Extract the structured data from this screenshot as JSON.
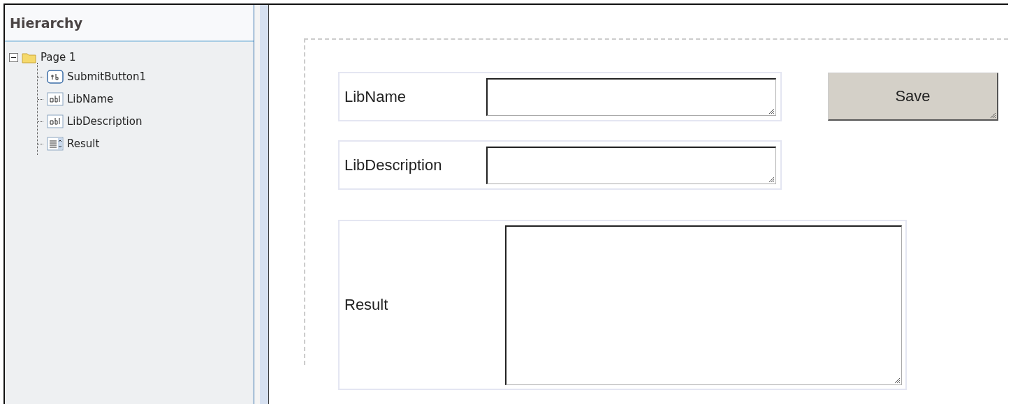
{
  "hierarchy": {
    "title": "Hierarchy",
    "tree": [
      {
        "label": "Page 1",
        "kind": "folder",
        "expanded": true,
        "children": [
          {
            "label": "SubmitButton1",
            "kind": "button"
          },
          {
            "label": "LibName",
            "kind": "textbox"
          },
          {
            "label": "LibDescription",
            "kind": "textbox"
          },
          {
            "label": "Result",
            "kind": "listbox"
          }
        ]
      }
    ]
  },
  "form": {
    "fields": [
      {
        "label": "LibName",
        "kind": "textbox"
      },
      {
        "label": "LibDescription",
        "kind": "textbox"
      },
      {
        "label": "Result",
        "kind": "textarea"
      }
    ],
    "save_button": "Save"
  }
}
